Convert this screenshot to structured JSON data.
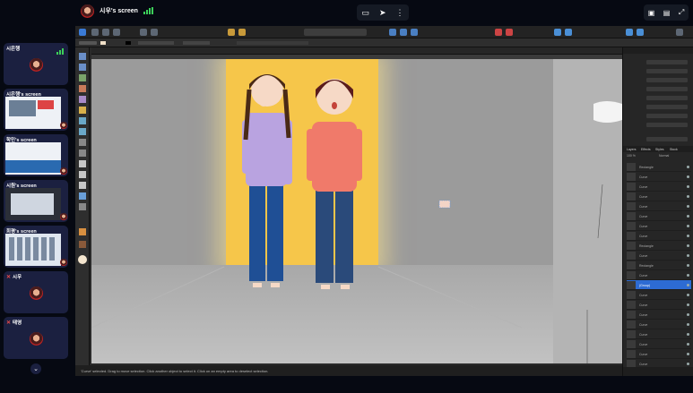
{
  "presenter": {
    "name": "시우's screen"
  },
  "controls": {
    "screen_icon": "monitor-icon",
    "pointer_icon": "pointer-icon",
    "more_icon": "more-icon"
  },
  "participants": [
    {
      "label": "시은행",
      "kind": "avatar"
    },
    {
      "label": "시은행's screen",
      "kind": "screen"
    },
    {
      "label": "학민's screen",
      "kind": "screen"
    },
    {
      "label": "시원's screen",
      "kind": "screen"
    },
    {
      "label": "희평's screen",
      "kind": "screen"
    },
    {
      "label": "시우",
      "kind": "avatar",
      "muted": true
    },
    {
      "label": "태영",
      "kind": "avatar",
      "muted": true
    }
  ],
  "app": {
    "tabs": [
      "Layers",
      "Effects",
      "Styles",
      "Stock"
    ],
    "layers": [
      "Rectangle",
      "Curve",
      "Curve",
      "Curve",
      "Curve",
      "Curve",
      "Curve",
      "Curve",
      "Rectangle",
      "Curve",
      "Rectangle",
      "Curve",
      "(Group)",
      "Curve",
      "Curve",
      "Curve",
      "Curve",
      "Curve",
      "Curve",
      "Curve",
      "Curve"
    ],
    "selected_layer_index": 12,
    "blend_mode": "Normal",
    "opacity": "100 %",
    "status_text": "'Curve' selected. Drag to move selection. Click another object to select it. Click on an empty area to deselect selection."
  },
  "colors": {
    "accent": "#2d6bd3",
    "spotlight": "#f6c64a",
    "signal": "#3ccf5a"
  }
}
